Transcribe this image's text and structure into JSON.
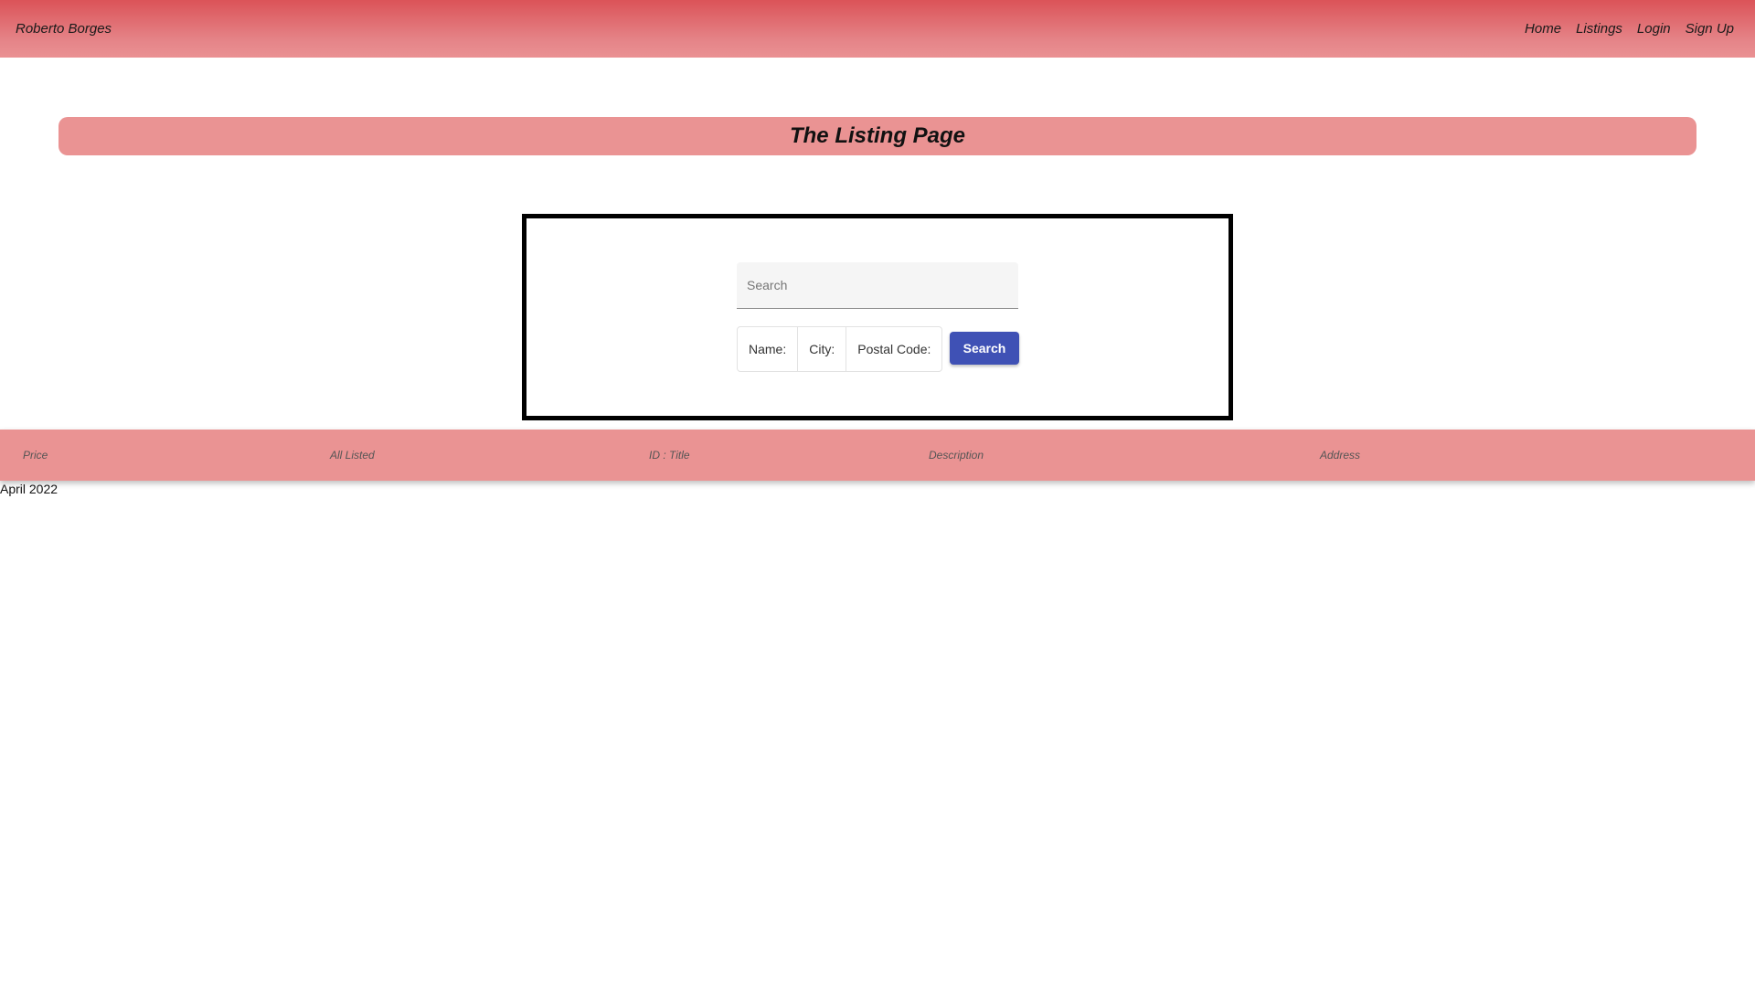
{
  "navbar": {
    "brand": "Roberto Borges",
    "links": [
      {
        "label": "Home"
      },
      {
        "label": "Listings"
      },
      {
        "label": "Login"
      },
      {
        "label": "Sign Up"
      }
    ],
    "background_start": "#db5358",
    "background_end": "#ea9193"
  },
  "banner": {
    "title": "The Listing Page",
    "color": "#ea9393"
  },
  "search": {
    "placeholder": "Search",
    "value": "",
    "filters": [
      {
        "label": "Name:"
      },
      {
        "label": "City:"
      },
      {
        "label": "Postal Code:"
      }
    ],
    "button_label": "Search",
    "button_color": "#3f51b5"
  },
  "table": {
    "columns": [
      {
        "label": "Price"
      },
      {
        "label": "All Listed"
      },
      {
        "label": "ID : Title"
      },
      {
        "label": "Description"
      },
      {
        "label": "Address"
      }
    ]
  },
  "footer": {
    "date": "April 2022"
  }
}
